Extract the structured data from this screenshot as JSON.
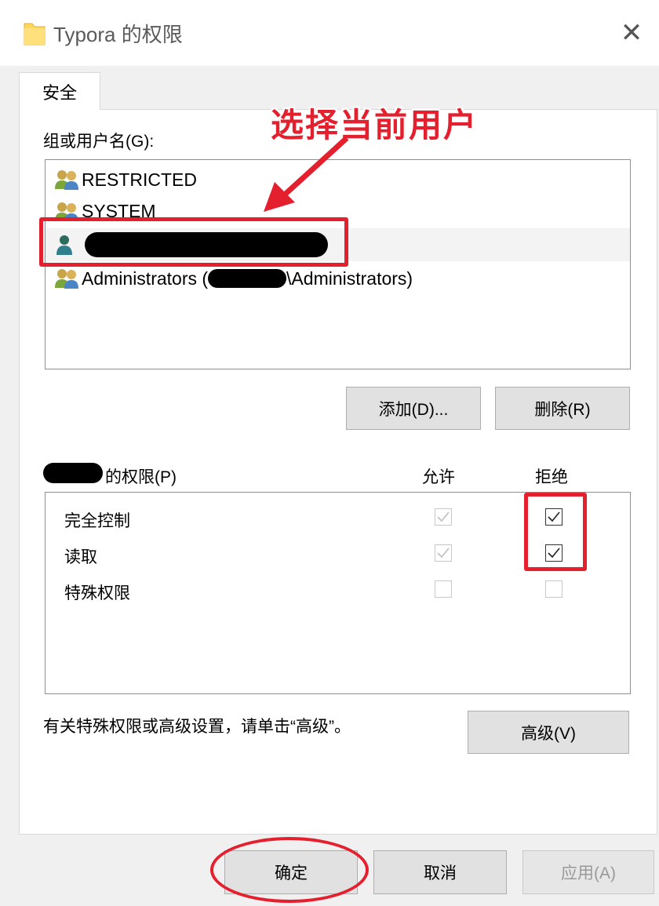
{
  "window": {
    "title": "Typora 的权限",
    "close_glyph": "✕"
  },
  "tabs": [
    {
      "label": "安全"
    }
  ],
  "users_section": {
    "label": "组或用户名(G):",
    "items": [
      {
        "name": "RESTRICTED",
        "icon": "user-group-icon"
      },
      {
        "name": "SYSTEM",
        "icon": "user-group-icon"
      },
      {
        "name": "",
        "icon": "user-icon",
        "redacted": true,
        "selected": true
      },
      {
        "name_prefix": "Administrators (",
        "name_suffix": "\\Administrators)",
        "icon": "user-group-icon"
      }
    ]
  },
  "buttons": {
    "add": "添加(D)...",
    "remove": "删除(R)",
    "advanced": "高级(V)",
    "ok": "确定",
    "cancel": "取消",
    "apply": "应用(A)"
  },
  "permissions": {
    "header_label": "的权限(P)",
    "col_allow": "允许",
    "col_deny": "拒绝",
    "rows": [
      {
        "name": "完全控制",
        "allow": true,
        "allow_disabled": true,
        "deny": true
      },
      {
        "name": "读取",
        "allow": true,
        "allow_disabled": true,
        "deny": true
      },
      {
        "name": "特殊权限",
        "allow": false,
        "allow_disabled": true,
        "deny": false
      }
    ]
  },
  "advanced_hint": "有关特殊权限或高级设置，请单击“高级”。",
  "annotation": {
    "text": "选择当前用户",
    "color": "#e5202e"
  }
}
